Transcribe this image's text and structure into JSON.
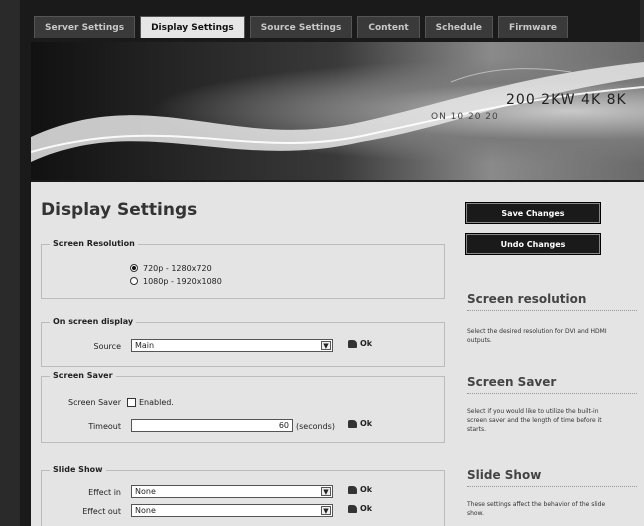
{
  "tabs": [
    {
      "label": "Server Settings",
      "active": false
    },
    {
      "label": "Display Settings",
      "active": true
    },
    {
      "label": "Source Settings",
      "active": false
    },
    {
      "label": "Content",
      "active": false
    },
    {
      "label": "Schedule",
      "active": false
    },
    {
      "label": "Firmware",
      "active": false
    }
  ],
  "banner": {
    "gauge_text": "200 2KW 4K 8K",
    "gauge_scale": "ON 10 20 20"
  },
  "page_title": "Display Settings",
  "screen_resolution": {
    "legend": "Screen Resolution",
    "options": [
      {
        "label": "720p - 1280x720",
        "selected": true
      },
      {
        "label": "1080p - 1920x1080",
        "selected": false
      }
    ]
  },
  "osd": {
    "legend": "On screen display",
    "source_label": "Source",
    "source_value": "Main",
    "ok": "Ok"
  },
  "screensaver": {
    "legend": "Screen Saver",
    "label": "Screen Saver",
    "checkbox_label": "Enabled.",
    "timeout_label": "Timeout",
    "timeout_value": "60",
    "timeout_unit": "(seconds)",
    "ok": "Ok"
  },
  "slideshow": {
    "legend": "Slide Show",
    "effect_in_label": "Effect in",
    "effect_in_value": "None",
    "effect_out_label": "Effect out",
    "effect_out_value": "None",
    "ok": "Ok"
  },
  "buttons": {
    "save": "Save Changes",
    "undo": "Undo Changes"
  },
  "sidebar": {
    "sections": [
      {
        "title": "Screen resolution",
        "text": "Select the desired resolution for DVI and HDMI outputs."
      },
      {
        "title": "Screen Saver",
        "text": "Select if you would like to utilize the built-in screen saver and the length of time before it starts."
      },
      {
        "title": "Slide Show",
        "text": "These settings affect the behavior of the slide show."
      }
    ]
  }
}
